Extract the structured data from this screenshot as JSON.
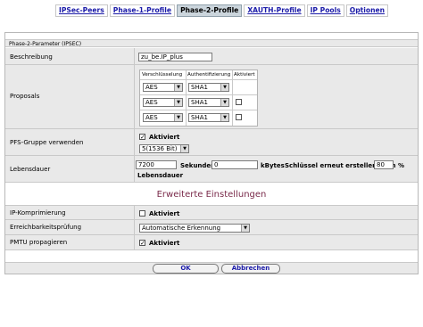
{
  "tabs": [
    {
      "label": "IPSec-Peers",
      "active": false
    },
    {
      "label": "Phase-1-Profile",
      "active": false
    },
    {
      "label": "Phase-2-Profile",
      "active": true
    },
    {
      "label": "XAUTH-Profile",
      "active": false
    },
    {
      "label": "IP Pools",
      "active": false
    },
    {
      "label": "Optionen",
      "active": false
    }
  ],
  "section_title": "Phase-2-Parameter (IPSEC)",
  "beschreibung": {
    "label": "Beschreibung",
    "value": "zu_be.IP_plus"
  },
  "proposals": {
    "label": "Proposals",
    "headers": [
      "Verschlüsselung",
      "Authentifizierung",
      "Aktiviert"
    ],
    "rows": [
      {
        "encryption": "AES",
        "auth": "SHA1",
        "active": null
      },
      {
        "encryption": "AES",
        "auth": "SHA1",
        "active": false
      },
      {
        "encryption": "AES",
        "auth": "SHA1",
        "active": false
      }
    ]
  },
  "pfs": {
    "label": "PFS-Gruppe verwenden",
    "checkbox_label": "Aktiviert",
    "checked": true,
    "group": "5(1536 Bit)"
  },
  "lebensdauer": {
    "label": "Lebensdauer",
    "seconds": "7200",
    "seconds_label": "Sekunden",
    "kbytes": "0",
    "kbytes_label": "kBytes",
    "renew_label": "Schlüssel erneut erstellen nach",
    "renew_value": "80",
    "percent": "%",
    "lifetime_label": "Lebensdauer"
  },
  "erweitert_title": "Erweiterte Einstellungen",
  "ip_komprimierung": {
    "label": "IP-Komprimierung",
    "checkbox_label": "Aktiviert",
    "checked": false
  },
  "erreichbarkeit": {
    "label": "Erreichbarkeitsprüfung",
    "value": "Automatische Erkennung"
  },
  "pmtu": {
    "label": "PMTU propagieren",
    "checkbox_label": "Aktiviert",
    "checked": true
  },
  "buttons": {
    "ok": "OK",
    "cancel": "Abbrechen"
  }
}
